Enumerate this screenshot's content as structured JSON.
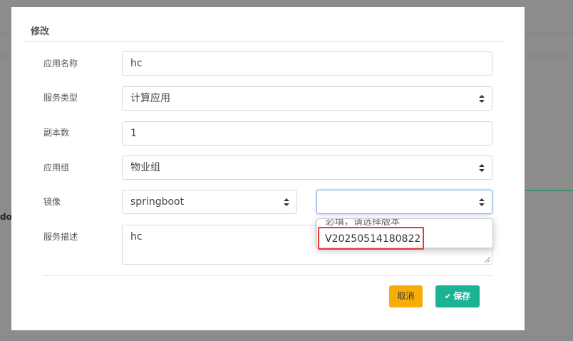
{
  "modal": {
    "title": "修改",
    "fields": {
      "app_name": {
        "label": "应用名称",
        "value": "hc"
      },
      "service_type": {
        "label": "服务类型",
        "value": "计算应用"
      },
      "replicas": {
        "label": "副本数",
        "value": "1"
      },
      "app_group": {
        "label": "应用组",
        "value": "物业组"
      },
      "image": {
        "label": "镜像",
        "value": "springboot",
        "version_value": ""
      },
      "description": {
        "label": "服务描述",
        "value": "hc"
      }
    },
    "version_dropdown": {
      "placeholder_option": "必填，请选择版本",
      "options": [
        "V20250514180822"
      ]
    },
    "buttons": {
      "cancel": "取消",
      "save": "保存"
    }
  },
  "background": {
    "partial_text": "do"
  },
  "colors": {
    "cancel": "#f8ac09",
    "save": "#1ab394",
    "highlight_border": "#e53935"
  }
}
